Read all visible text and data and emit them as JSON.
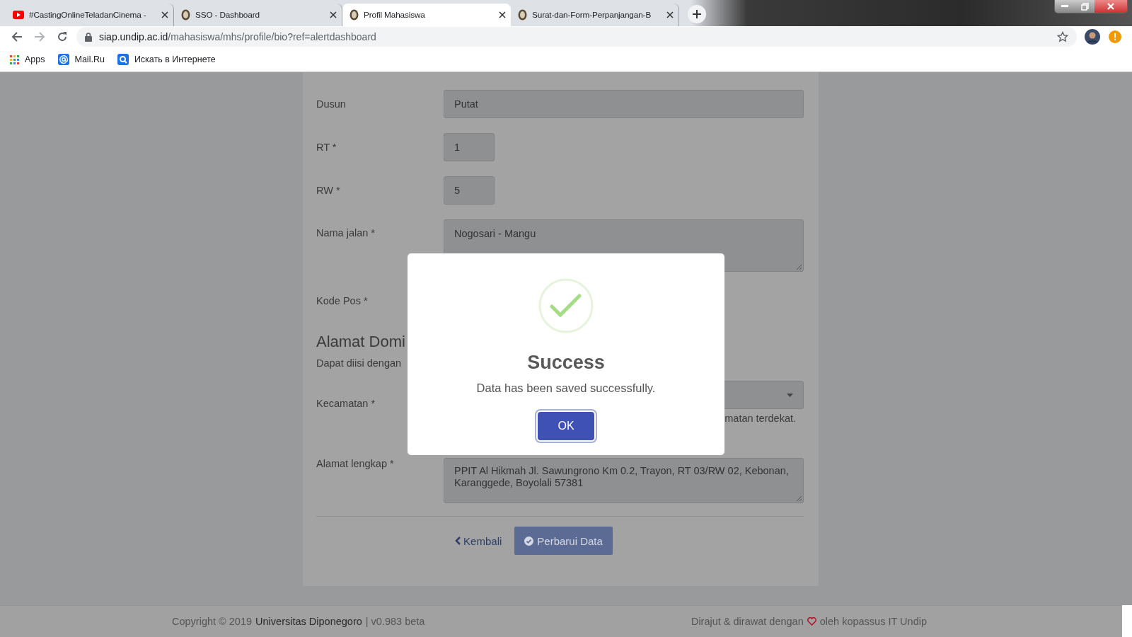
{
  "browser": {
    "tabs": [
      {
        "title": "#CastingOnlineTeladanCinema -",
        "kind": "video",
        "selected": false
      },
      {
        "title": "SSO - Dashboard",
        "kind": "seal",
        "selected": false
      },
      {
        "title": "Profil Mahasiswa",
        "kind": "seal",
        "selected": true
      },
      {
        "title": "Surat-dan-Form-Perpanjangan-B",
        "kind": "seal",
        "selected": false
      }
    ],
    "url_host": "siap.undip.ac.id",
    "url_path": "/mahasiswa/mhs/profile/bio?ref=alertdashboard",
    "bookmarks": [
      {
        "label": "Apps",
        "kind": "apps"
      },
      {
        "label": "Mail.Ru",
        "kind": "mail"
      },
      {
        "label": "Искать в Интернете",
        "kind": "search"
      }
    ]
  },
  "form": {
    "fields": [
      {
        "label": "Dusun",
        "value": "Putat",
        "kind": "text"
      },
      {
        "label": "RT *",
        "value": "1",
        "kind": "short"
      },
      {
        "label": "RW *",
        "value": "5",
        "kind": "short"
      },
      {
        "label": "Nama jalan *",
        "value": "Nogosari - Mangu",
        "kind": "textarea"
      },
      {
        "label": "Kode Pos *",
        "kind": "covered"
      }
    ],
    "section_title": "Alamat Domi",
    "section_note": "Dapat diisi dengan",
    "fields2": [
      {
        "label": "Kecamatan *",
        "kind": "select",
        "help": "matan terdekat."
      },
      {
        "label": "Alamat lengkap *",
        "kind": "textarea",
        "lines": [
          "PPIT Al Hikmah Jl. Sawungrono Km 0.2, Trayon, RT 03/RW 02, Kebonan,",
          "Karanggede, Boyolali 57381"
        ]
      }
    ],
    "back_link": "Kembali",
    "submit": "Perbarui Data"
  },
  "dialog": {
    "title": "Success",
    "message": "Data has been saved successfully.",
    "button": "OK"
  },
  "footer": {
    "copyright": "Copyright © 2019",
    "link": "Universitas Diponegoro",
    "version": "| v0.983 beta",
    "credit_before": "Dirajut & dirawat dengan",
    "credit_after": "oleh kopassus IT Undip"
  }
}
